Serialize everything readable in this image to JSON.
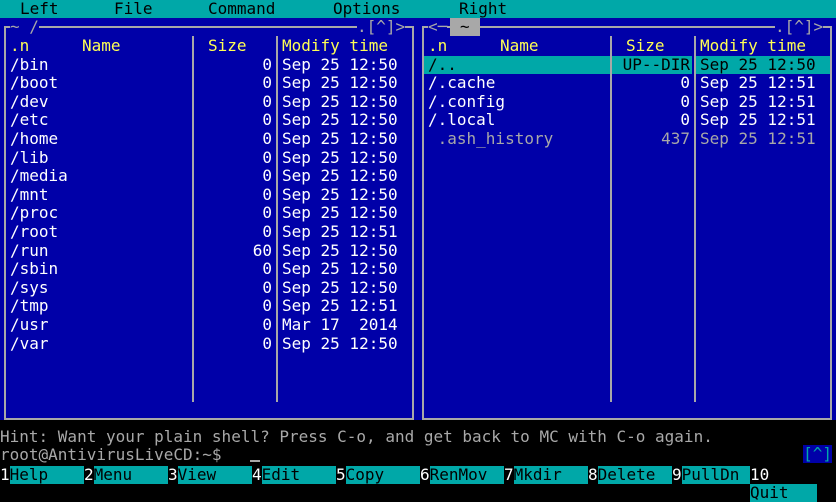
{
  "menu": [
    "Left",
    "File",
    "Command",
    "Options",
    "Right"
  ],
  "left_panel": {
    "path": "~ /",
    "corner": ".[^]>",
    "columns": [
      ".n",
      "Name",
      "Size",
      "Modify time"
    ],
    "rows": [
      {
        "name": "/bin",
        "size": "0",
        "time": "Sep 25 12:50"
      },
      {
        "name": "/boot",
        "size": "0",
        "time": "Sep 25 12:50"
      },
      {
        "name": "/dev",
        "size": "0",
        "time": "Sep 25 12:50"
      },
      {
        "name": "/etc",
        "size": "0",
        "time": "Sep 25 12:50"
      },
      {
        "name": "/home",
        "size": "0",
        "time": "Sep 25 12:50"
      },
      {
        "name": "/lib",
        "size": "0",
        "time": "Sep 25 12:50"
      },
      {
        "name": "/media",
        "size": "0",
        "time": "Sep 25 12:50"
      },
      {
        "name": "/mnt",
        "size": "0",
        "time": "Sep 25 12:50"
      },
      {
        "name": "/proc",
        "size": "0",
        "time": "Sep 25 12:50"
      },
      {
        "name": "/root",
        "size": "0",
        "time": "Sep 25 12:51"
      },
      {
        "name": "/run",
        "size": "60",
        "time": "Sep 25 12:50"
      },
      {
        "name": "/sbin",
        "size": "0",
        "time": "Sep 25 12:50"
      },
      {
        "name": "/sys",
        "size": "0",
        "time": "Sep 25 12:50"
      },
      {
        "name": "/tmp",
        "size": "0",
        "time": "Sep 25 12:51"
      },
      {
        "name": "/usr",
        "size": "0",
        "time": "Mar 17  2014"
      },
      {
        "name": "/var",
        "size": "0",
        "time": "Sep 25 12:50"
      }
    ]
  },
  "right_panel": {
    "path": "~",
    "corner": ".[^]>",
    "columns": [
      ".n",
      "Name",
      "Size",
      "Modify time"
    ],
    "rows": [
      {
        "name": "/..",
        "size": "UP--DIR",
        "time": "Sep 25 12:50",
        "selected": true
      },
      {
        "name": "/.cache",
        "size": "0",
        "time": "Sep 25 12:51"
      },
      {
        "name": "/.config",
        "size": "0",
        "time": "Sep 25 12:51"
      },
      {
        "name": "/.local",
        "size": "0",
        "time": "Sep 25 12:51"
      },
      {
        "name": " .ash_history",
        "size": "437",
        "time": "Sep 25 12:51",
        "dim": true
      }
    ]
  },
  "hint": "Hint: Want your plain shell? Press C-o, and get back to MC with C-o again.",
  "prompt": "root@AntivirusLiveCD:~$",
  "shell_marker": "[^]",
  "fkeys": [
    {
      "num": "1",
      "label": "Help"
    },
    {
      "num": "2",
      "label": "Menu"
    },
    {
      "num": "3",
      "label": "View"
    },
    {
      "num": "4",
      "label": "Edit"
    },
    {
      "num": "5",
      "label": "Copy"
    },
    {
      "num": "6",
      "label": "RenMov"
    },
    {
      "num": "7",
      "label": "Mkdir"
    },
    {
      "num": "8",
      "label": "Delete"
    },
    {
      "num": "9",
      "label": "PullDn"
    },
    {
      "num": "10",
      "label": "Quit"
    }
  ],
  "colors": {
    "panel_bg": "#0000A8",
    "bar": "#00A8A8",
    "header": "#FFFF54",
    "text": "#FFFFFF"
  }
}
